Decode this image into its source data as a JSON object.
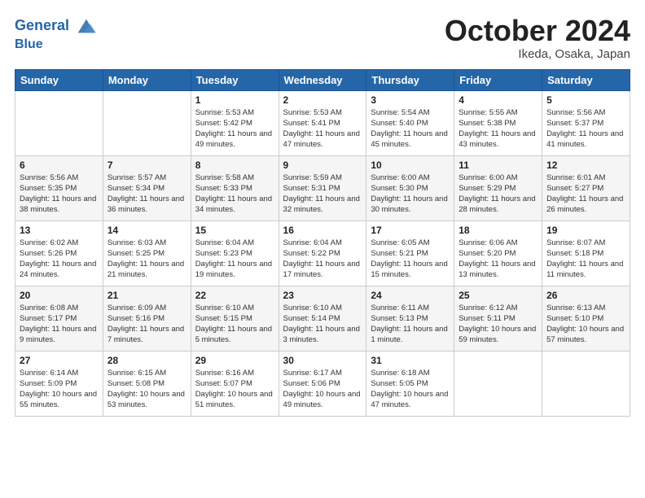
{
  "header": {
    "logo_line1": "General",
    "logo_line2": "Blue",
    "month": "October 2024",
    "location": "Ikeda, Osaka, Japan"
  },
  "weekdays": [
    "Sunday",
    "Monday",
    "Tuesday",
    "Wednesday",
    "Thursday",
    "Friday",
    "Saturday"
  ],
  "weeks": [
    [
      {
        "day": "",
        "sunrise": "",
        "sunset": "",
        "daylight": ""
      },
      {
        "day": "",
        "sunrise": "",
        "sunset": "",
        "daylight": ""
      },
      {
        "day": "1",
        "sunrise": "Sunrise: 5:53 AM",
        "sunset": "Sunset: 5:42 PM",
        "daylight": "Daylight: 11 hours and 49 minutes."
      },
      {
        "day": "2",
        "sunrise": "Sunrise: 5:53 AM",
        "sunset": "Sunset: 5:41 PM",
        "daylight": "Daylight: 11 hours and 47 minutes."
      },
      {
        "day": "3",
        "sunrise": "Sunrise: 5:54 AM",
        "sunset": "Sunset: 5:40 PM",
        "daylight": "Daylight: 11 hours and 45 minutes."
      },
      {
        "day": "4",
        "sunrise": "Sunrise: 5:55 AM",
        "sunset": "Sunset: 5:38 PM",
        "daylight": "Daylight: 11 hours and 43 minutes."
      },
      {
        "day": "5",
        "sunrise": "Sunrise: 5:56 AM",
        "sunset": "Sunset: 5:37 PM",
        "daylight": "Daylight: 11 hours and 41 minutes."
      }
    ],
    [
      {
        "day": "6",
        "sunrise": "Sunrise: 5:56 AM",
        "sunset": "Sunset: 5:35 PM",
        "daylight": "Daylight: 11 hours and 38 minutes."
      },
      {
        "day": "7",
        "sunrise": "Sunrise: 5:57 AM",
        "sunset": "Sunset: 5:34 PM",
        "daylight": "Daylight: 11 hours and 36 minutes."
      },
      {
        "day": "8",
        "sunrise": "Sunrise: 5:58 AM",
        "sunset": "Sunset: 5:33 PM",
        "daylight": "Daylight: 11 hours and 34 minutes."
      },
      {
        "day": "9",
        "sunrise": "Sunrise: 5:59 AM",
        "sunset": "Sunset: 5:31 PM",
        "daylight": "Daylight: 11 hours and 32 minutes."
      },
      {
        "day": "10",
        "sunrise": "Sunrise: 6:00 AM",
        "sunset": "Sunset: 5:30 PM",
        "daylight": "Daylight: 11 hours and 30 minutes."
      },
      {
        "day": "11",
        "sunrise": "Sunrise: 6:00 AM",
        "sunset": "Sunset: 5:29 PM",
        "daylight": "Daylight: 11 hours and 28 minutes."
      },
      {
        "day": "12",
        "sunrise": "Sunrise: 6:01 AM",
        "sunset": "Sunset: 5:27 PM",
        "daylight": "Daylight: 11 hours and 26 minutes."
      }
    ],
    [
      {
        "day": "13",
        "sunrise": "Sunrise: 6:02 AM",
        "sunset": "Sunset: 5:26 PM",
        "daylight": "Daylight: 11 hours and 24 minutes."
      },
      {
        "day": "14",
        "sunrise": "Sunrise: 6:03 AM",
        "sunset": "Sunset: 5:25 PM",
        "daylight": "Daylight: 11 hours and 21 minutes."
      },
      {
        "day": "15",
        "sunrise": "Sunrise: 6:04 AM",
        "sunset": "Sunset: 5:23 PM",
        "daylight": "Daylight: 11 hours and 19 minutes."
      },
      {
        "day": "16",
        "sunrise": "Sunrise: 6:04 AM",
        "sunset": "Sunset: 5:22 PM",
        "daylight": "Daylight: 11 hours and 17 minutes."
      },
      {
        "day": "17",
        "sunrise": "Sunrise: 6:05 AM",
        "sunset": "Sunset: 5:21 PM",
        "daylight": "Daylight: 11 hours and 15 minutes."
      },
      {
        "day": "18",
        "sunrise": "Sunrise: 6:06 AM",
        "sunset": "Sunset: 5:20 PM",
        "daylight": "Daylight: 11 hours and 13 minutes."
      },
      {
        "day": "19",
        "sunrise": "Sunrise: 6:07 AM",
        "sunset": "Sunset: 5:18 PM",
        "daylight": "Daylight: 11 hours and 11 minutes."
      }
    ],
    [
      {
        "day": "20",
        "sunrise": "Sunrise: 6:08 AM",
        "sunset": "Sunset: 5:17 PM",
        "daylight": "Daylight: 11 hours and 9 minutes."
      },
      {
        "day": "21",
        "sunrise": "Sunrise: 6:09 AM",
        "sunset": "Sunset: 5:16 PM",
        "daylight": "Daylight: 11 hours and 7 minutes."
      },
      {
        "day": "22",
        "sunrise": "Sunrise: 6:10 AM",
        "sunset": "Sunset: 5:15 PM",
        "daylight": "Daylight: 11 hours and 5 minutes."
      },
      {
        "day": "23",
        "sunrise": "Sunrise: 6:10 AM",
        "sunset": "Sunset: 5:14 PM",
        "daylight": "Daylight: 11 hours and 3 minutes."
      },
      {
        "day": "24",
        "sunrise": "Sunrise: 6:11 AM",
        "sunset": "Sunset: 5:13 PM",
        "daylight": "Daylight: 11 hours and 1 minute."
      },
      {
        "day": "25",
        "sunrise": "Sunrise: 6:12 AM",
        "sunset": "Sunset: 5:11 PM",
        "daylight": "Daylight: 10 hours and 59 minutes."
      },
      {
        "day": "26",
        "sunrise": "Sunrise: 6:13 AM",
        "sunset": "Sunset: 5:10 PM",
        "daylight": "Daylight: 10 hours and 57 minutes."
      }
    ],
    [
      {
        "day": "27",
        "sunrise": "Sunrise: 6:14 AM",
        "sunset": "Sunset: 5:09 PM",
        "daylight": "Daylight: 10 hours and 55 minutes."
      },
      {
        "day": "28",
        "sunrise": "Sunrise: 6:15 AM",
        "sunset": "Sunset: 5:08 PM",
        "daylight": "Daylight: 10 hours and 53 minutes."
      },
      {
        "day": "29",
        "sunrise": "Sunrise: 6:16 AM",
        "sunset": "Sunset: 5:07 PM",
        "daylight": "Daylight: 10 hours and 51 minutes."
      },
      {
        "day": "30",
        "sunrise": "Sunrise: 6:17 AM",
        "sunset": "Sunset: 5:06 PM",
        "daylight": "Daylight: 10 hours and 49 minutes."
      },
      {
        "day": "31",
        "sunrise": "Sunrise: 6:18 AM",
        "sunset": "Sunset: 5:05 PM",
        "daylight": "Daylight: 10 hours and 47 minutes."
      },
      {
        "day": "",
        "sunrise": "",
        "sunset": "",
        "daylight": ""
      },
      {
        "day": "",
        "sunrise": "",
        "sunset": "",
        "daylight": ""
      }
    ]
  ]
}
